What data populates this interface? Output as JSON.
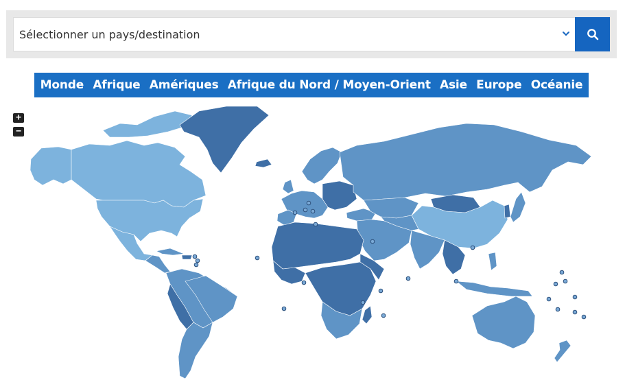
{
  "search": {
    "select_label": "Sélectionner un pays/destination"
  },
  "regions": [
    {
      "label": "Monde"
    },
    {
      "label": "Afrique"
    },
    {
      "label": "Amériques"
    },
    {
      "label": "Afrique du Nord / Moyen-Orient"
    },
    {
      "label": "Asie"
    },
    {
      "label": "Europe"
    },
    {
      "label": "Océanie"
    }
  ],
  "zoom": {
    "in_label": "+",
    "out_label": "−"
  },
  "colors": {
    "accent": "#1565c0",
    "nav": "#1a6fc4",
    "level_light": "#7db3dd",
    "level_mid": "#5f94c6",
    "level_dark": "#3f6fa6"
  }
}
